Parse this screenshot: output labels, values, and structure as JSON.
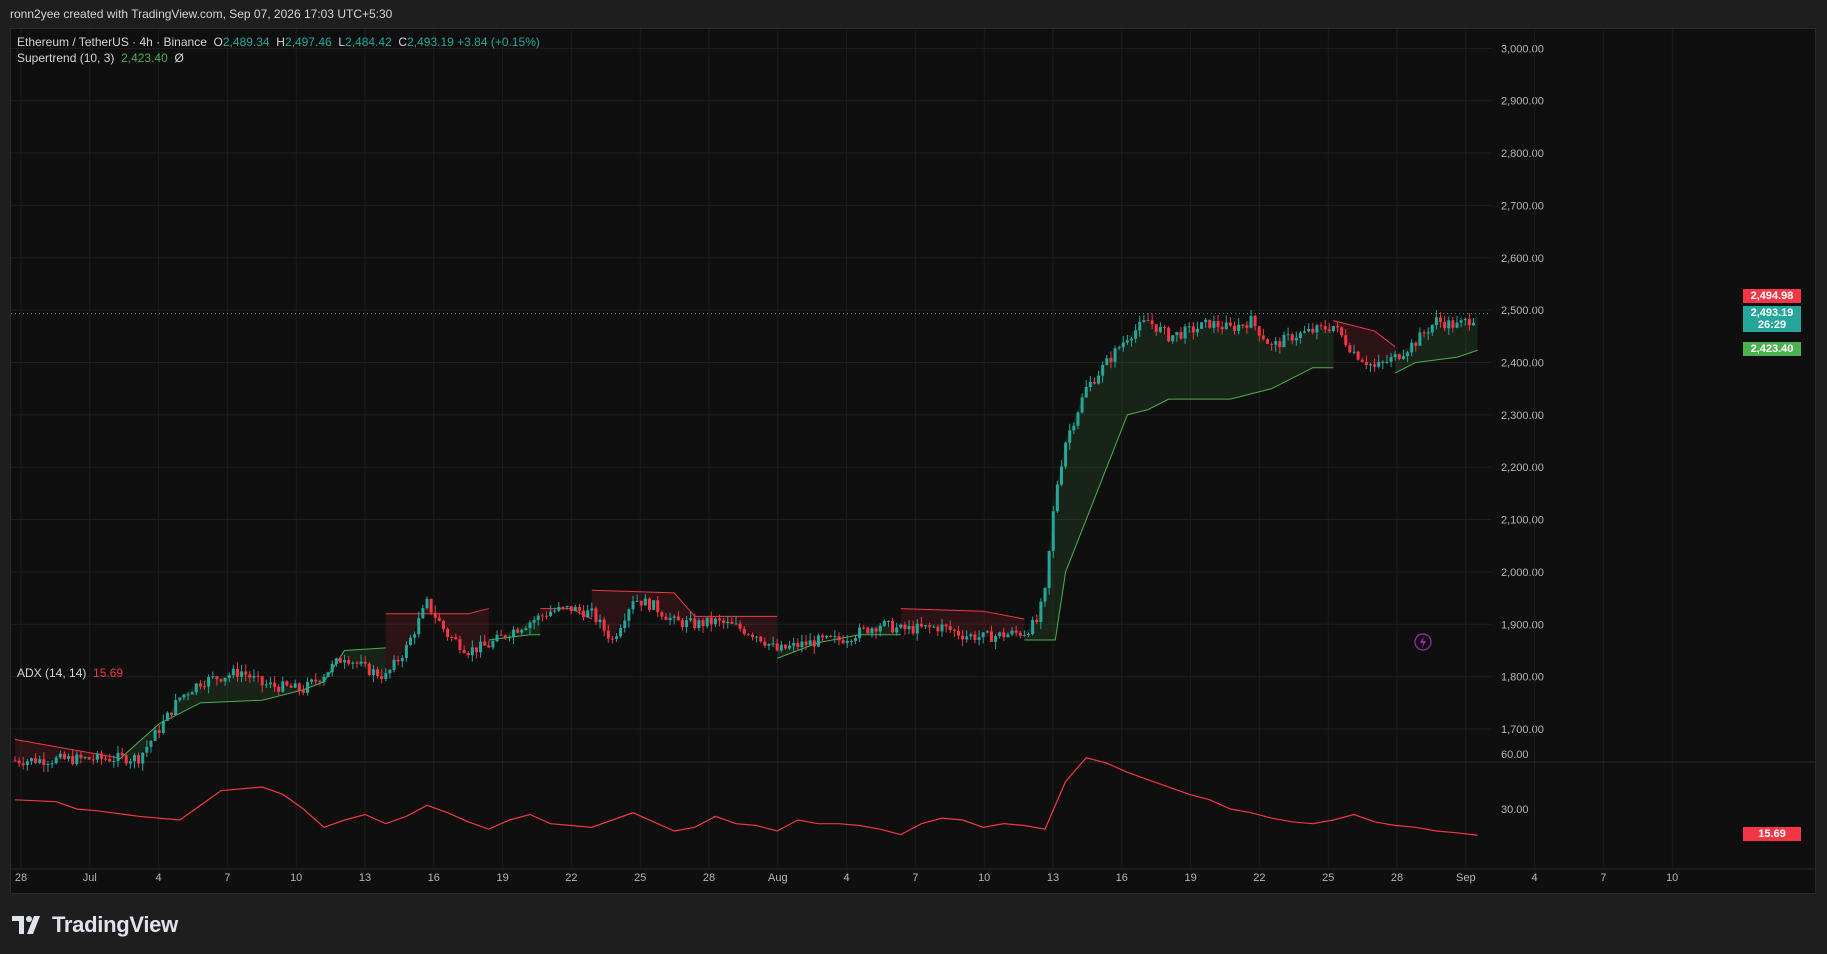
{
  "header": {
    "credit": "ronn2yee created with TradingView.com, Sep 07, 2026 17:03 UTC+5:30"
  },
  "legend": {
    "symbol": "Ethereum / TetherUS · 4h · Binance",
    "o_label": "O",
    "o_value": "2,489.34",
    "h_label": "H",
    "h_value": "2,497.46",
    "l_label": "L",
    "l_value": "2,484.42",
    "c_label": "C",
    "c_value": "2,493.19",
    "change": "+3.84 (+0.15%)",
    "supertrend_label": "Supertrend (10, 3)",
    "supertrend_value": "2,423.40",
    "supertrend_extra": "Ø",
    "adx_label": "ADX (14, 14)",
    "adx_value": "15.69"
  },
  "price_tags": {
    "upper": "2,494.98",
    "last": "2,493.19",
    "countdown": "26:29",
    "supertrend": "2,423.40",
    "adx": "15.69"
  },
  "colors": {
    "up": "#26a69a",
    "down": "#f23645",
    "supertrend_up": "#4caf50",
    "supertrend_down": "#f23645",
    "adx_line": "#f23645"
  },
  "brand": {
    "name": "TradingView"
  },
  "chart_data": [
    {
      "type": "candlestick",
      "title": "Ethereum / TetherUS · 4h · Binance",
      "x_ticks": [
        "28",
        "Jul",
        "4",
        "7",
        "10",
        "13",
        "16",
        "19",
        "22",
        "25",
        "28",
        "Aug",
        "4",
        "7",
        "10",
        "13",
        "16",
        "19",
        "22",
        "25",
        "28",
        "Sep",
        "4",
        "7",
        "10"
      ],
      "y_ticks": [
        1700,
        1800,
        1900,
        2000,
        2100,
        2200,
        2300,
        2400,
        2500,
        2600,
        2700,
        2800,
        2900,
        3000
      ],
      "y_tick_labels": [
        "1,700.00",
        "1,800.00",
        "1,900.00",
        "2,000.00",
        "2,100.00",
        "2,200.00",
        "2,300.00",
        "2,400.00",
        "2,500.00",
        "2,600.00",
        "2,700.00",
        "2,800.00",
        "2,900.00",
        "3,000.00"
      ],
      "ylim": [
        1620,
        3020
      ],
      "close_path": [
        [
          0,
          1640
        ],
        [
          6,
          1645
        ],
        [
          7,
          1700
        ],
        [
          8,
          1760
        ],
        [
          9,
          1790
        ],
        [
          10,
          1800
        ],
        [
          11,
          1810
        ],
        [
          12,
          1785
        ],
        [
          13,
          1780
        ],
        [
          14,
          1775
        ],
        [
          15,
          1805
        ],
        [
          16,
          1840
        ],
        [
          17,
          1815
        ],
        [
          18,
          1800
        ],
        [
          19,
          1855
        ],
        [
          20,
          1940
        ],
        [
          21,
          1880
        ],
        [
          22,
          1850
        ],
        [
          23,
          1860
        ],
        [
          24,
          1885
        ],
        [
          25,
          1905
        ],
        [
          26,
          1925
        ],
        [
          27,
          1930
        ],
        [
          28,
          1920
        ],
        [
          29,
          1870
        ],
        [
          30,
          1950
        ],
        [
          31,
          1935
        ],
        [
          32,
          1905
        ],
        [
          33,
          1900
        ],
        [
          34,
          1905
        ],
        [
          35,
          1895
        ],
        [
          36,
          1880
        ],
        [
          37,
          1850
        ],
        [
          38,
          1860
        ],
        [
          39,
          1868
        ],
        [
          40,
          1870
        ],
        [
          41,
          1885
        ],
        [
          42,
          1900
        ],
        [
          43,
          1890
        ],
        [
          44,
          1892
        ],
        [
          45,
          1895
        ],
        [
          46,
          1880
        ],
        [
          47,
          1875
        ],
        [
          48,
          1880
        ],
        [
          49,
          1885
        ],
        [
          49.6,
          1905
        ],
        [
          50,
          1960
        ],
        [
          50.5,
          2150
        ],
        [
          51,
          2250
        ],
        [
          52,
          2350
        ],
        [
          53,
          2400
        ],
        [
          54,
          2450
        ],
        [
          55,
          2480
        ],
        [
          56,
          2450
        ],
        [
          57,
          2460
        ],
        [
          58,
          2475
        ],
        [
          59,
          2465
        ],
        [
          60,
          2480
        ],
        [
          61,
          2430
        ],
        [
          62,
          2450
        ],
        [
          63,
          2460
        ],
        [
          64,
          2470
        ],
        [
          65,
          2420
        ],
        [
          66,
          2390
        ],
        [
          67,
          2410
        ],
        [
          68,
          2440
        ],
        [
          69,
          2480
        ],
        [
          70,
          2470
        ],
        [
          71,
          2490
        ]
      ],
      "supertrend": {
        "period": 10,
        "multiplier": 3,
        "last_value": 2423.4,
        "segments": [
          {
            "trend": "down",
            "points": [
              [
                0,
                1680
              ],
              [
                5,
                1645
              ]
            ]
          },
          {
            "trend": "up",
            "points": [
              [
                5,
                1640
              ],
              [
                7,
                1710
              ],
              [
                9,
                1750
              ],
              [
                12,
                1755
              ],
              [
                14,
                1775
              ],
              [
                15,
                1790
              ],
              [
                16,
                1850
              ],
              [
                18,
                1855
              ]
            ]
          },
          {
            "trend": "down",
            "points": [
              [
                18,
                1920
              ],
              [
                22,
                1920
              ],
              [
                23,
                1930
              ]
            ]
          },
          {
            "trend": "up",
            "points": [
              [
                23,
                1870
              ],
              [
                25,
                1880
              ],
              [
                25.5,
                1880
              ]
            ]
          },
          {
            "trend": "down",
            "points": [
              [
                25.5,
                1930
              ],
              [
                27,
                1930
              ],
              [
                28,
                1910
              ]
            ]
          },
          {
            "trend": "down",
            "points": [
              [
                28,
                1965
              ],
              [
                32,
                1960
              ],
              [
                33,
                1915
              ],
              [
                37,
                1915
              ]
            ]
          },
          {
            "trend": "up",
            "points": [
              [
                37,
                1835
              ],
              [
                39,
                1865
              ],
              [
                41,
                1880
              ],
              [
                43,
                1880
              ]
            ]
          },
          {
            "trend": "down",
            "points": [
              [
                43,
                1930
              ],
              [
                47,
                1925
              ],
              [
                49,
                1910
              ]
            ]
          },
          {
            "trend": "up",
            "points": [
              [
                49,
                1870
              ],
              [
                50.5,
                1870
              ],
              [
                51,
                2000
              ],
              [
                52,
                2100
              ],
              [
                53,
                2200
              ],
              [
                54,
                2300
              ],
              [
                55,
                2310
              ],
              [
                56,
                2330
              ],
              [
                59,
                2330
              ],
              [
                60,
                2340
              ],
              [
                61,
                2350
              ],
              [
                63,
                2390
              ],
              [
                64,
                2390
              ]
            ]
          },
          {
            "trend": "down",
            "points": [
              [
                64,
                2480
              ],
              [
                66,
                2460
              ],
              [
                67,
                2430
              ]
            ]
          },
          {
            "trend": "up",
            "points": [
              [
                67,
                2380
              ],
              [
                68,
                2400
              ],
              [
                70,
                2410
              ],
              [
                71,
                2423.4
              ]
            ]
          }
        ]
      }
    },
    {
      "type": "line",
      "title": "ADX (14, 14)",
      "series": [
        {
          "name": "ADX (14, 14)",
          "x": [
            0,
            2,
            3,
            4,
            6,
            8,
            9,
            10,
            12,
            13,
            14,
            15,
            16,
            17,
            18,
            19,
            20,
            21,
            22,
            23,
            24,
            25,
            26,
            27,
            28,
            29,
            30,
            31,
            32,
            33,
            34,
            35,
            36,
            37,
            38,
            39,
            40,
            41,
            42,
            43,
            44,
            45,
            46,
            47,
            48,
            49,
            50,
            51,
            52,
            53,
            54,
            55,
            56,
            57,
            58,
            59,
            60,
            61,
            62,
            63,
            64,
            65,
            66,
            67,
            68,
            69,
            70,
            71
          ],
          "values": [
            35,
            34,
            30,
            29,
            26,
            24,
            32,
            40,
            42,
            38,
            30,
            20,
            24,
            27,
            22,
            26,
            32,
            28,
            23,
            19,
            24,
            27,
            22,
            21,
            20,
            24,
            28,
            23,
            18,
            20,
            26,
            22,
            21,
            18,
            24,
            22,
            22,
            21,
            19,
            16,
            22,
            25,
            24,
            20,
            22,
            21,
            19,
            45,
            58,
            55,
            50,
            46,
            42,
            38,
            35,
            30,
            28,
            25,
            23,
            22,
            24,
            27,
            23,
            21,
            20,
            18,
            17,
            15.69
          ]
        }
      ],
      "y_ticks": [
        30,
        60
      ],
      "y_tick_labels": [
        "30.00",
        "60.00"
      ],
      "ylim": [
        10,
        67
      ]
    }
  ]
}
